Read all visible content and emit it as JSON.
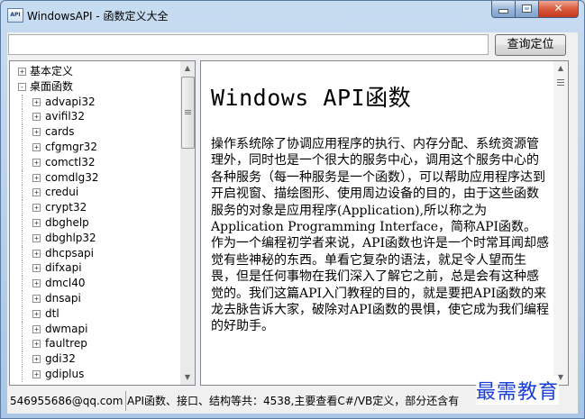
{
  "window": {
    "icon_text": "API",
    "title": "WindowsAPI - 函数定义大全"
  },
  "search": {
    "value": "",
    "button_label": "查询定位"
  },
  "tree": {
    "items": [
      {
        "label": "基本定义",
        "level": 0,
        "expander": "+"
      },
      {
        "label": "桌面函数",
        "level": 0,
        "expander": "-"
      },
      {
        "label": "advapi32",
        "level": 1,
        "expander": "+"
      },
      {
        "label": "avifil32",
        "level": 1,
        "expander": "+"
      },
      {
        "label": "cards",
        "level": 1,
        "expander": "+"
      },
      {
        "label": "cfgmgr32",
        "level": 1,
        "expander": "+"
      },
      {
        "label": "comctl32",
        "level": 1,
        "expander": "+"
      },
      {
        "label": "comdlg32",
        "level": 1,
        "expander": "+"
      },
      {
        "label": "credui",
        "level": 1,
        "expander": "+"
      },
      {
        "label": "crypt32",
        "level": 1,
        "expander": "+"
      },
      {
        "label": "dbghelp",
        "level": 1,
        "expander": "+"
      },
      {
        "label": "dbghlp32",
        "level": 1,
        "expander": "+"
      },
      {
        "label": "dhcpsapi",
        "level": 1,
        "expander": "+"
      },
      {
        "label": "difxapi",
        "level": 1,
        "expander": "+"
      },
      {
        "label": "dmcl40",
        "level": 1,
        "expander": "+"
      },
      {
        "label": "dnsapi",
        "level": 1,
        "expander": "+"
      },
      {
        "label": "dtl",
        "level": 1,
        "expander": "+"
      },
      {
        "label": "dwmapi",
        "level": 1,
        "expander": "+"
      },
      {
        "label": "faultrep",
        "level": 1,
        "expander": "+"
      },
      {
        "label": "gdi32",
        "level": 1,
        "expander": "+"
      },
      {
        "label": "gdiplus",
        "level": 1,
        "expander": "+"
      }
    ]
  },
  "document": {
    "title": "Windows API函数",
    "paragraphs": [
      "操作系统除了协调应用程序的执行、内存分配、系统资源管理外，同时也是一个很大的服务中心，调用这个服务中心的各种服务（每一种服务是一个函数），可以帮助应用程序达到开启视窗、描绘图形、使用周边设备的目的，由于这些函数服务的对象是应用程序(Application),所以称之为Application Programming Interface，简称API函数。",
      "作为一个编程初学者来说，API函数也许是一个时常耳闻却感觉有些神秘的东西。单看它复杂的语法，就足令人望而生畏，但是任何事物在我们深入了解它之前，总是会有这种感觉的。我们这篇API入门教程的目的，就是要把API函数的来龙去脉告诉大家，破除对API函数的畏惧，使它成为我们编程的好助手。"
    ]
  },
  "status": {
    "email": "546955686@qq.com",
    "info": "API函数、接口、结构等共：4538,主要查看C#/VB定义，部分还含有"
  },
  "watermark": "最需教育"
}
